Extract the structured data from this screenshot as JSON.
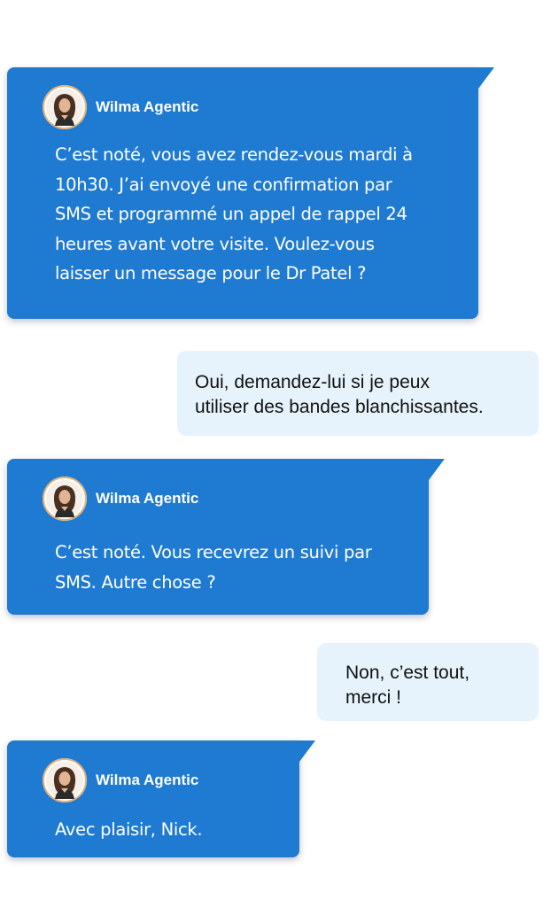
{
  "conversation": {
    "messages": [
      {
        "role": "agent",
        "sender": "Wilma Agentic",
        "text": "C’est noté, vous avez rendez-vous mardi à\n10h30. J’ai envoyé une confirmation par\nSMS et programmé un appel de rappel 24\nheures avant votre visite. Voulez-vous\nlaisser un message pour le Dr Patel ?"
      },
      {
        "role": "user",
        "text": "Oui, demandez-lui si je peux\nutiliser des bandes blanchissantes."
      },
      {
        "role": "agent",
        "sender": "Wilma Agentic",
        "text": "C’est noté. Vous recevrez un suivi par\nSMS. Autre chose ?"
      },
      {
        "role": "user",
        "text": "Non, c’est tout,\nmerci !"
      },
      {
        "role": "agent",
        "sender": "Wilma Agentic",
        "text": "Avec plaisir, Nick."
      }
    ]
  },
  "colors": {
    "agent_bubble": "#1f7ad1",
    "user_bubble": "#e6f3fc",
    "agent_text": "#ffffff",
    "user_text": "#111111"
  },
  "icons": {
    "avatar": "agent-avatar-portrait"
  }
}
